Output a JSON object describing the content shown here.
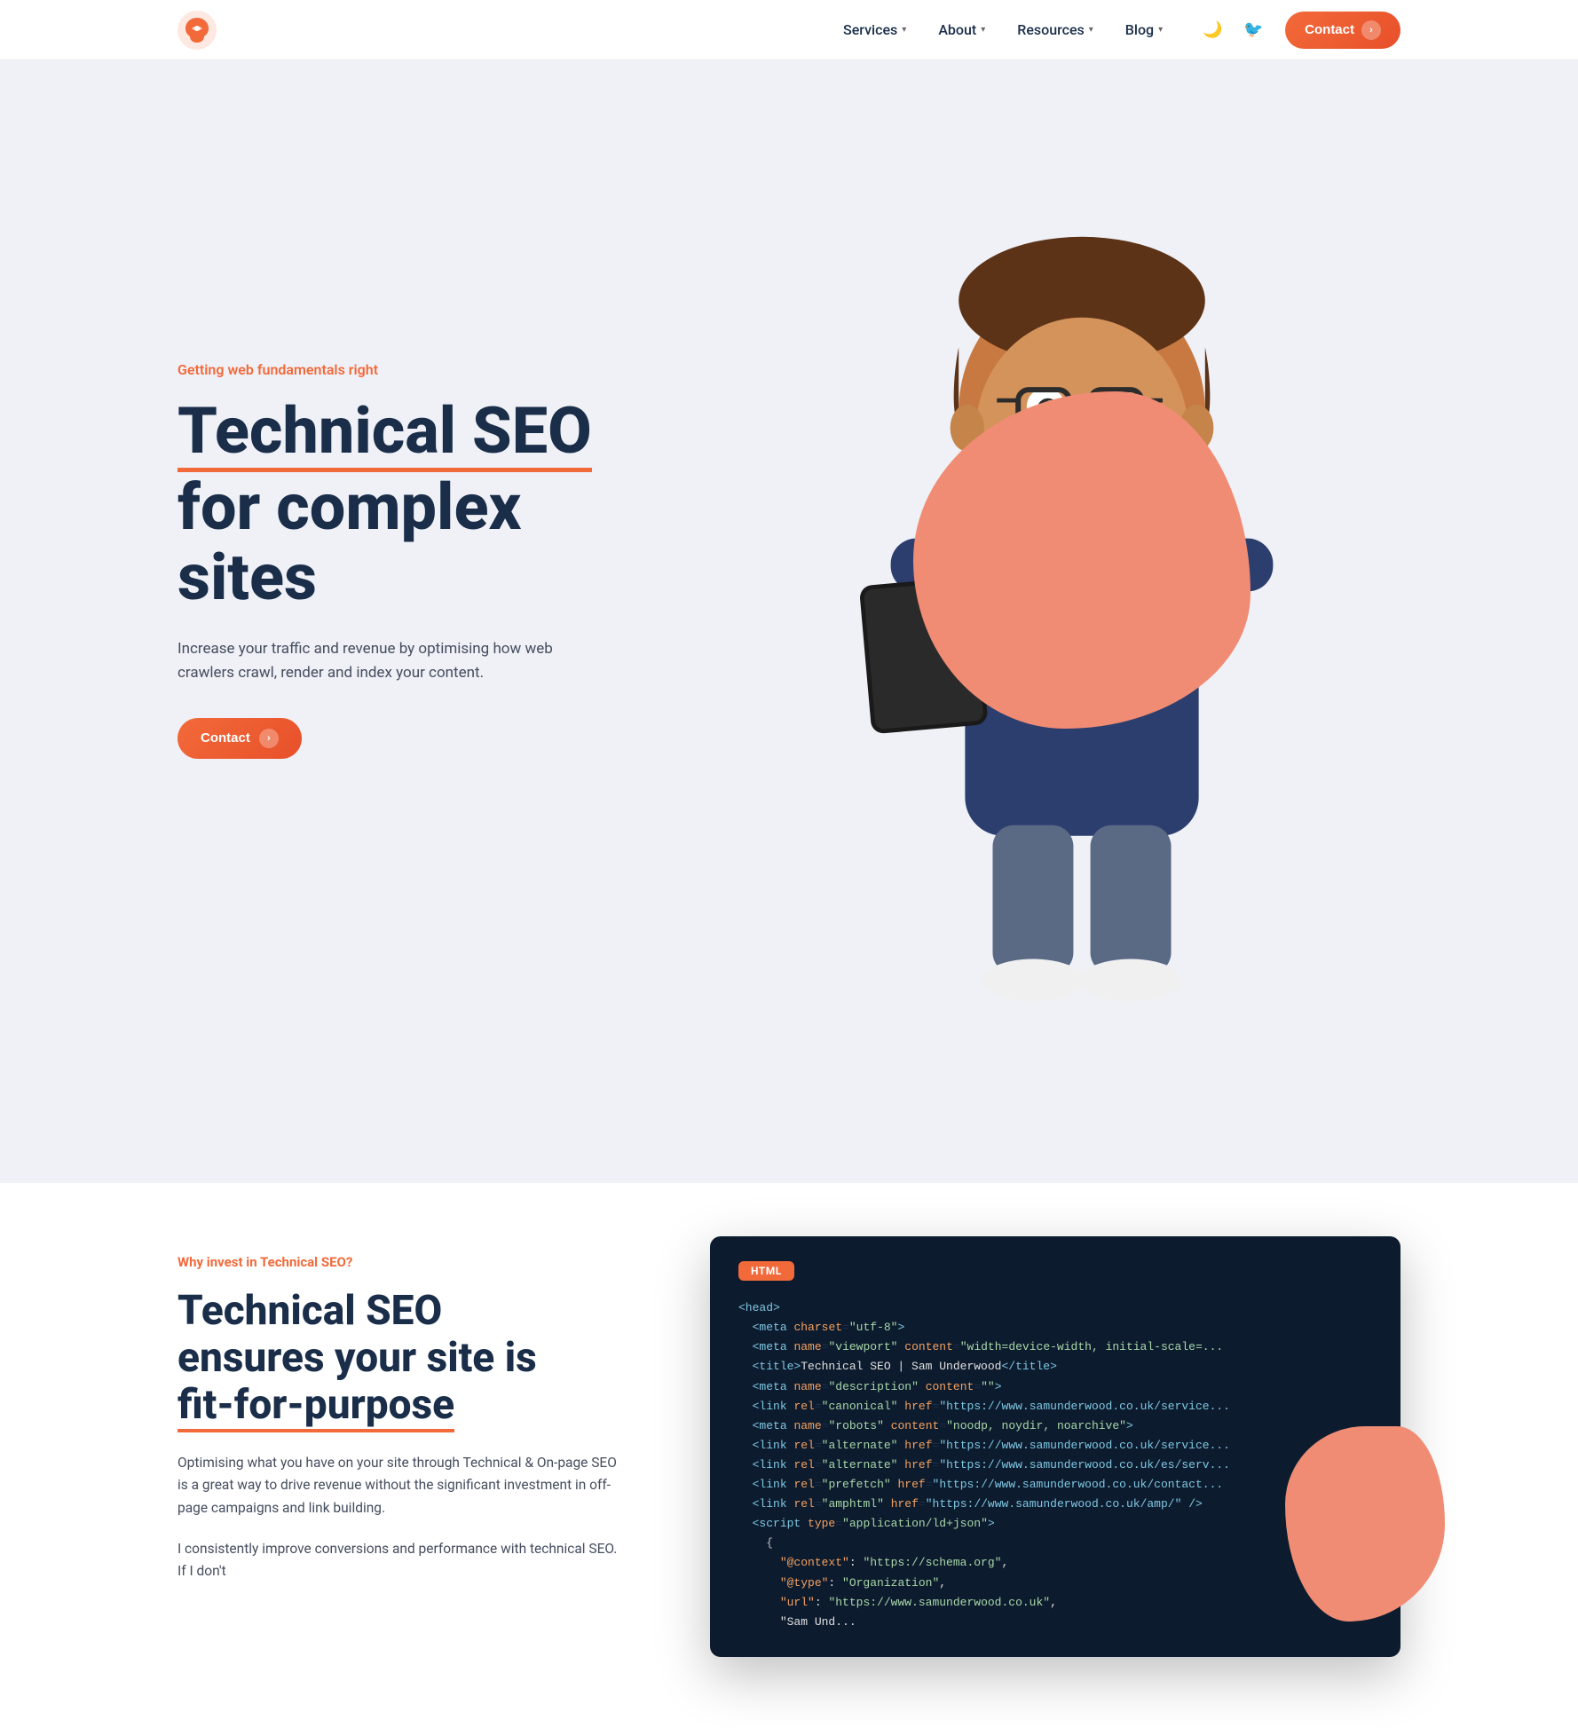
{
  "nav": {
    "links": [
      {
        "label": "Services",
        "has_dropdown": true
      },
      {
        "label": "About",
        "has_dropdown": true
      },
      {
        "label": "Resources",
        "has_dropdown": true
      },
      {
        "label": "Blog",
        "has_dropdown": true
      }
    ],
    "contact_label": "Contact",
    "dark_mode_icon": "🌙",
    "twitter_icon": "🐦"
  },
  "hero": {
    "eyebrow": "Getting web fundamentals right",
    "title_line1": "Technical SEO",
    "title_line2": "for complex",
    "title_line3": "sites",
    "title_underline": "Technical SEO",
    "description": "Increase your traffic and revenue by optimising how web crawlers crawl, render and index your content.",
    "cta_label": "Contact"
  },
  "second": {
    "eyebrow": "Why invest in Technical SEO?",
    "title_part1": "Technical SEO",
    "title_part2": "ensures your site is",
    "title_underline": "fit-for-purpose",
    "desc1": "Optimising what you have on your site through Technical & On-page SEO is a great way to drive revenue without the significant investment in off-page campaigns and link building.",
    "desc2": "I consistently improve conversions and performance with technical SEO. If I don't"
  },
  "code_block": {
    "tab": "HTML",
    "lines": [
      {
        "text": "<head>",
        "type": "tag"
      },
      {
        "indent": 2,
        "tag": "meta",
        "attr": "charset",
        "val": "\"utf-8\"",
        "close": ">"
      },
      {
        "indent": 2,
        "tag": "meta",
        "attr": "name",
        "val": "\"viewport\"",
        "attr2": "content",
        "val2": "\"width=device-width, initial-scale=..."
      },
      {
        "indent": 2,
        "tag": "title",
        "inner": "Technical SEO | Sam Underwood",
        "close_tag": "title"
      },
      {
        "indent": 2,
        "tag": "meta",
        "attr": "name",
        "val": "\"description\"",
        "attr2": "content",
        "val2": "\"\""
      },
      {
        "indent": 2,
        "tag": "link",
        "attr": "rel",
        "val": "\"canonical\"",
        "attr2": "href",
        "val2": "\"https://www.samunderwood.co.uk/service..."
      },
      {
        "indent": 2,
        "tag": "meta",
        "attr": "name",
        "val": "\"robots\"",
        "attr2": "content",
        "val2": "\"noodp, noydir, noarchive\""
      },
      {
        "indent": 2,
        "tag": "link",
        "attr": "rel",
        "val": "\"alternate\"",
        "attr2": "href",
        "val2": "\"https://www.samunderwood.co.uk/service..."
      },
      {
        "indent": 2,
        "tag": "link",
        "attr": "rel",
        "val": "\"alternate\"",
        "attr2": "href",
        "val2": "\"https://www.samunderwood.co.uk/es/serv..."
      },
      {
        "indent": 2,
        "tag": "link",
        "attr": "rel",
        "val": "\"prefetch\"",
        "attr2": "href",
        "val2": "\"https://www.samunderwood.co.uk/contact..."
      },
      {
        "indent": 2,
        "tag": "link",
        "attr": "rel",
        "val": "\"amphtml\"",
        "attr2": "href",
        "val2": "\"https://www.samunderwood.co.uk/amp/\"",
        "self_close": true
      },
      {
        "indent": 2,
        "tag": "script",
        "attr": "type",
        "val": "\"application/ld+json\"",
        "close": ">"
      },
      {
        "indent": 4,
        "plain": "{"
      },
      {
        "indent": 6,
        "key": "\"@context\"",
        "val": "\"https://schema.org\","
      },
      {
        "indent": 6,
        "key": "\"@type\"",
        "val": "\"Organization\","
      },
      {
        "indent": 6,
        "key": "\"url\"",
        "val": "\"https://www.samunderwood.co.uk\","
      },
      {
        "indent": 6,
        "text": "\"Sam Und..."
      }
    ]
  }
}
